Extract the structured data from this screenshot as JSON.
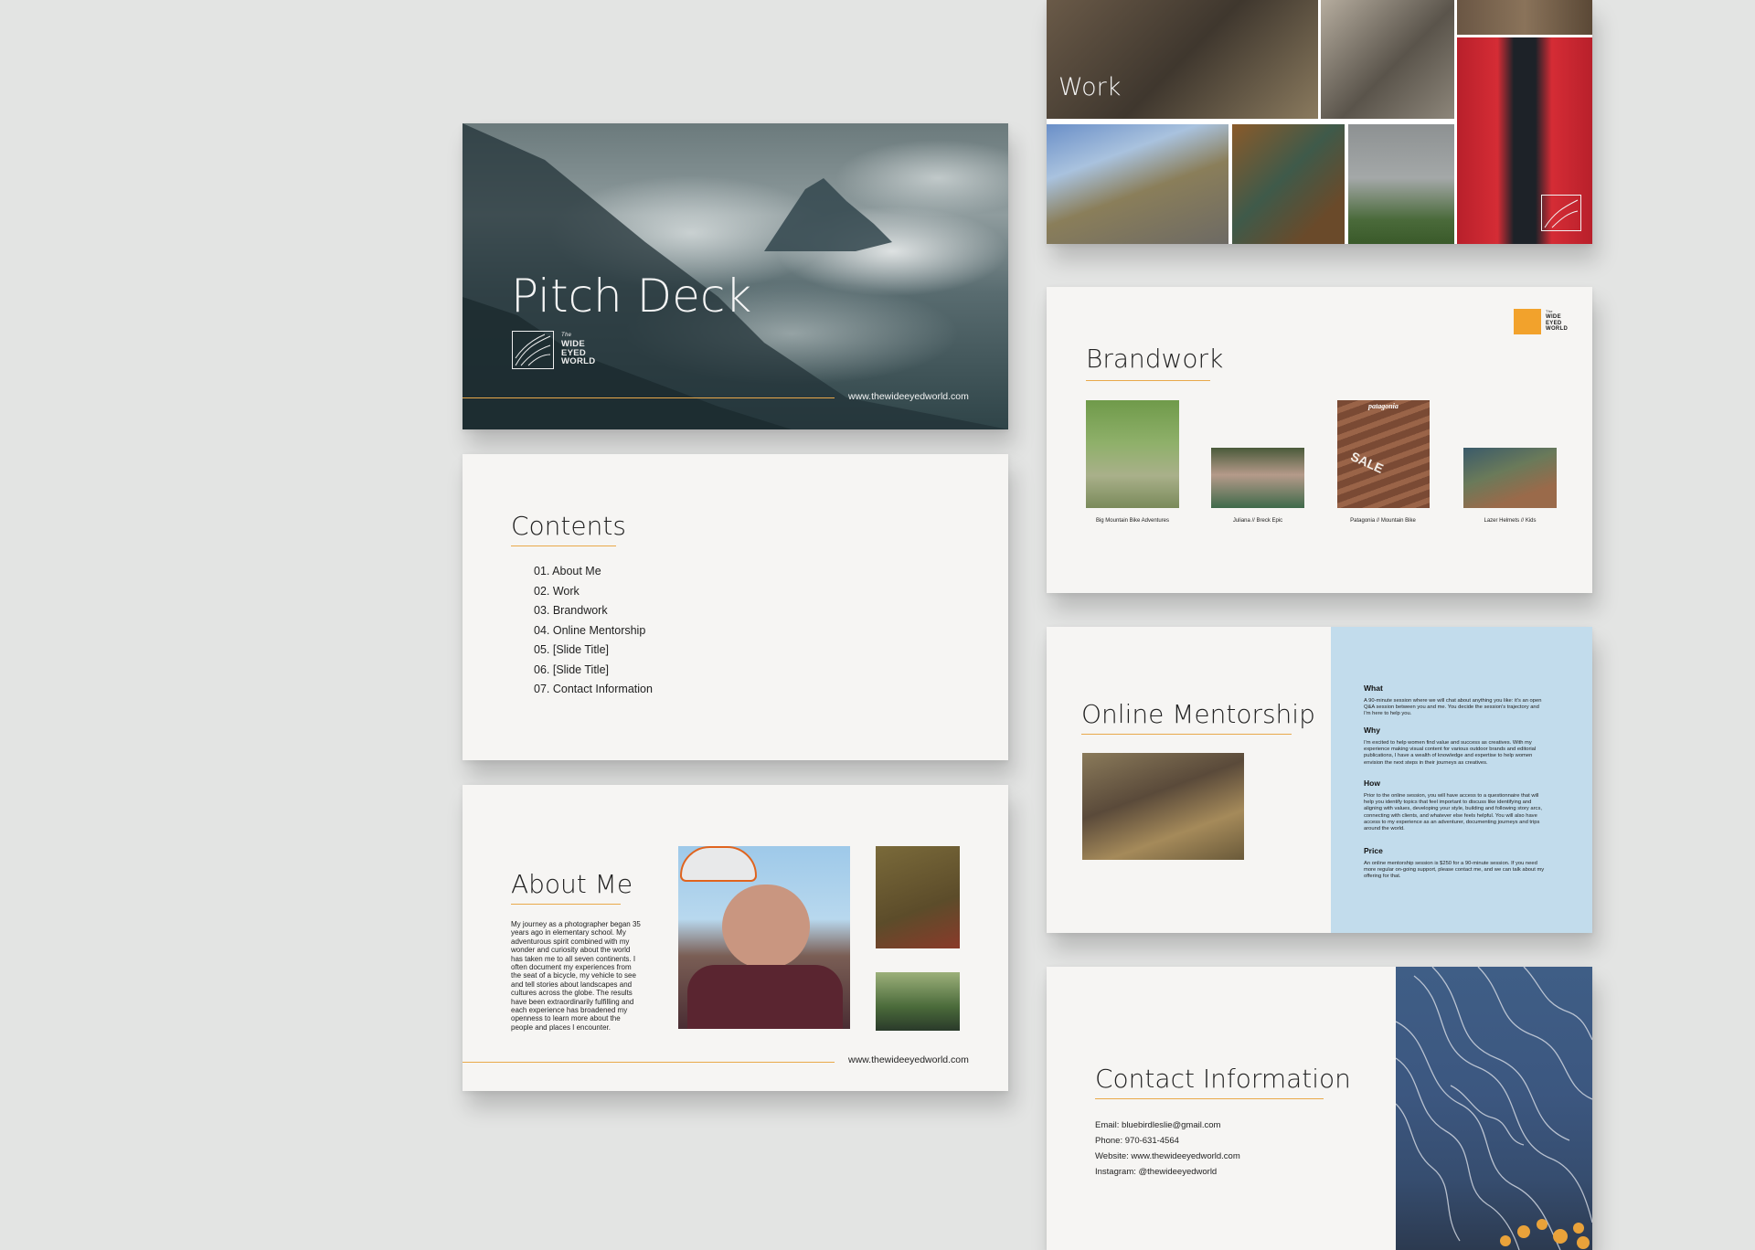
{
  "pitch": {
    "title": "Pitch Deck",
    "logo_lines": [
      "The",
      "WIDE",
      "EYED",
      "WORLD"
    ],
    "url": "www.thewideeyedworld.com"
  },
  "contents": {
    "title": "Contents",
    "items": [
      "01. About Me",
      "02. Work",
      "03. Brandwork",
      "04. Online Mentorship",
      "05. [Slide Title]",
      "06. [Slide Title]",
      "07. Contact Information"
    ]
  },
  "about": {
    "title": "About Me",
    "body": "My journey as a photographer began 35 years ago in elementary school. My adventurous spirit combined with my wonder and curiosity about the world has taken me to all seven continents. I often document my experiences from the seat of a bicycle, my vehicle to see and tell stories about landscapes and cultures across the globe. The results have been extraordinarily fulfilling and each experience has broadened my openness to learn more about the people and places I encounter.",
    "url": "www.thewideeyedworld.com"
  },
  "work": {
    "title": "Work"
  },
  "brandwork": {
    "title": "Brandwork",
    "logo_lines": [
      "The",
      "WIDE",
      "EYED",
      "WORLD"
    ],
    "items": [
      {
        "caption": "Big Mountain Bike Adventures"
      },
      {
        "caption": "Juliana // Breck Epic"
      },
      {
        "caption": "Patagonia // Mountain Bike",
        "overlay_brand": "patagonia",
        "overlay_text": "SALE"
      },
      {
        "caption": "Lazer Helmets // Kids"
      }
    ]
  },
  "mentorship": {
    "title": "Online Mentorship",
    "sections": [
      {
        "heading": "What",
        "text": "A 90-minute session where we will chat about anything you like: it's an open Q&A session between you and me. You decide the session's trajectory and I'm here to help you."
      },
      {
        "heading": "Why",
        "text": "I'm excited to help women find value and success as creatives. With my experience making visual content for various outdoor brands and editorial publications, I have a wealth of knowledge and expertise to help women envision the next steps in their journeys as creatives."
      },
      {
        "heading": "How",
        "text": "Prior to the online session, you will have access to a questionnaire that will help you identify topics that feel important to discuss like identifying and aligning with values, developing your style, building and following story arcs, connecting with clients, and whatever else feels helpful. You will also have access to my experience as an adventurer, documenting journeys and trips around the world."
      },
      {
        "heading": "Price",
        "text": "An online mentorship session is $250 for a 90-minute session. If you need more regular on-going support, please contact me, and we can talk about my offering for that."
      }
    ]
  },
  "contact": {
    "title": "Contact Information",
    "lines": [
      "Email: bluebirdleslie@gmail.com",
      "Phone: 970-631-4564",
      "Website: www.thewideeyedworld.com",
      "Instagram: @thewideeyedworld"
    ]
  }
}
